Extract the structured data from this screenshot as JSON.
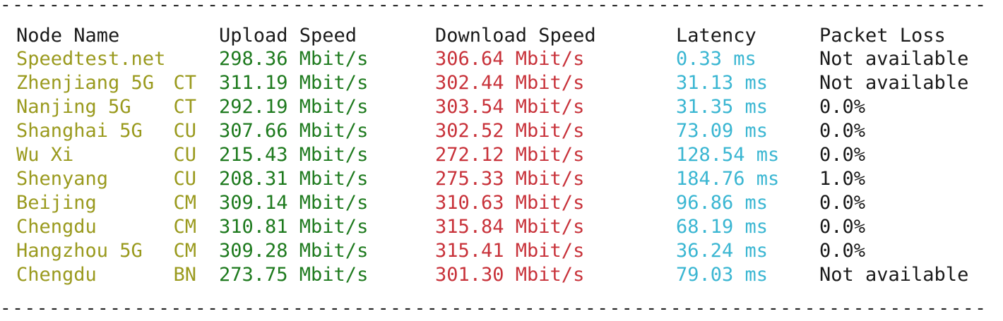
{
  "rule_text": "--------------------------------------------------------------------------------------------------------------------------------",
  "header": {
    "node_name": "Node Name",
    "upload": "Upload Speed",
    "download": "Download Speed",
    "latency": "Latency",
    "packet_loss": "Packet Loss"
  },
  "colors": {
    "node": "#9a9a1e",
    "upload": "#1e7a1e",
    "download": "#c8323a",
    "latency": "#3ab6d2",
    "text": "#1a1a1a"
  },
  "rows": [
    {
      "name": "Speedtest.net",
      "isp": "",
      "upload": "298.36 Mbit/s",
      "download": "306.64 Mbit/s",
      "latency": "0.33 ms",
      "loss": "Not available"
    },
    {
      "name": "Zhenjiang 5G",
      "isp": "CT",
      "upload": "311.19 Mbit/s",
      "download": "302.44 Mbit/s",
      "latency": "31.13 ms",
      "loss": "Not available"
    },
    {
      "name": "Nanjing 5G",
      "isp": "CT",
      "upload": "292.19 Mbit/s",
      "download": "303.54 Mbit/s",
      "latency": "31.35 ms",
      "loss": "0.0%"
    },
    {
      "name": "Shanghai 5G",
      "isp": "CU",
      "upload": "307.66 Mbit/s",
      "download": "302.52 Mbit/s",
      "latency": "73.09 ms",
      "loss": "0.0%"
    },
    {
      "name": "Wu Xi",
      "isp": "CU",
      "upload": "215.43 Mbit/s",
      "download": "272.12 Mbit/s",
      "latency": "128.54 ms",
      "loss": "0.0%"
    },
    {
      "name": "Shenyang",
      "isp": "CU",
      "upload": "208.31 Mbit/s",
      "download": "275.33 Mbit/s",
      "latency": "184.76 ms",
      "loss": "1.0%"
    },
    {
      "name": "Beijing",
      "isp": "CM",
      "upload": "309.14 Mbit/s",
      "download": "310.63 Mbit/s",
      "latency": "96.86 ms",
      "loss": "0.0%"
    },
    {
      "name": "Chengdu",
      "isp": "CM",
      "upload": "310.81 Mbit/s",
      "download": "315.84 Mbit/s",
      "latency": "68.19 ms",
      "loss": "0.0%"
    },
    {
      "name": "Hangzhou 5G",
      "isp": "CM",
      "upload": "309.28 Mbit/s",
      "download": "315.41 Mbit/s",
      "latency": "36.24 ms",
      "loss": "0.0%"
    },
    {
      "name": "Chengdu",
      "isp": "BN",
      "upload": "273.75 Mbit/s",
      "download": "301.30 Mbit/s",
      "latency": "79.03 ms",
      "loss": "Not available"
    }
  ]
}
